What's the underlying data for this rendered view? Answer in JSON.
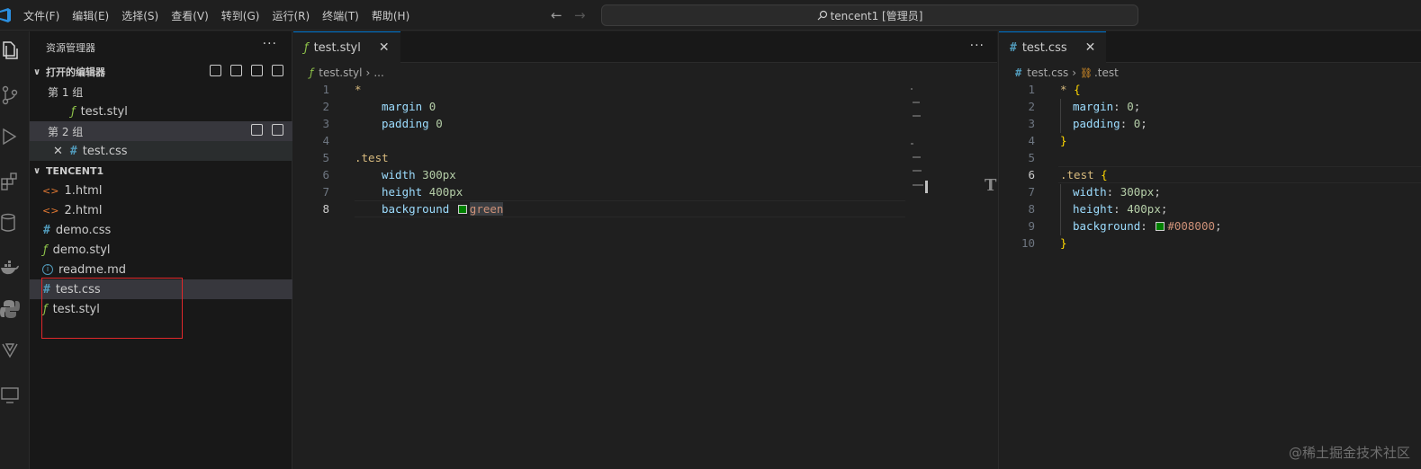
{
  "menu": [
    "文件(F)",
    "编辑(E)",
    "选择(S)",
    "查看(V)",
    "转到(G)",
    "运行(R)",
    "终端(T)",
    "帮助(H)"
  ],
  "search": {
    "text": "tencent1 [管理员]"
  },
  "sidebar": {
    "title": "资源管理器",
    "more": "···",
    "open_editors": {
      "label": "打开的编辑器",
      "group1": {
        "label": "第 1 组",
        "file": "test.styl"
      },
      "group2": {
        "label": "第 2 组",
        "file": "test.css",
        "close": "✕"
      }
    },
    "folder": {
      "label": "TENCENT1",
      "files": [
        "1.html",
        "2.html",
        "demo.css",
        "demo.styl",
        "readme.md",
        "test.css",
        "test.styl"
      ]
    }
  },
  "editor1": {
    "tab_label": "test.styl",
    "tab_close": "✕",
    "more": "···",
    "breadcrumb_file": "test.styl",
    "breadcrumb_more": "...",
    "line_numbers": [
      "1",
      "2",
      "3",
      "4",
      "5",
      "6",
      "7",
      "8"
    ],
    "code": {
      "l1": "*",
      "l2_prop": "margin",
      "l2_val": "0",
      "l3_prop": "padding",
      "l3_val": "0",
      "l5": ".test",
      "l6_prop": "width",
      "l6_val": "300px",
      "l7_prop": "height",
      "l7_val": "400px",
      "l8_prop": "background",
      "l8_val": "green"
    },
    "split_glyph": "T"
  },
  "editor2": {
    "tab_label": "test.css",
    "tab_close": "✕",
    "breadcrumb_file": "test.css",
    "breadcrumb_symbol": ".test",
    "line_numbers": [
      "1",
      "2",
      "3",
      "4",
      "5",
      "6",
      "7",
      "8",
      "9",
      "10"
    ],
    "code": {
      "l1_sel": "*",
      "l1_brace": "{",
      "l2_prop": "margin",
      "l2_val": "0",
      "l3_prop": "padding",
      "l3_val": "0",
      "l4": "}",
      "l6_sel": ".test",
      "l6_brace": "{",
      "l7_prop": "width",
      "l7_val": "300px",
      "l8_prop": "height",
      "l8_val": "400px",
      "l9_prop": "background",
      "l9_val": "#008000",
      "l10": "}"
    }
  },
  "watermark": "@稀土掘金技术社区",
  "colors": {
    "accent": "#0078d4",
    "highlight_box": "#e0282b",
    "swatch": "#008000"
  }
}
